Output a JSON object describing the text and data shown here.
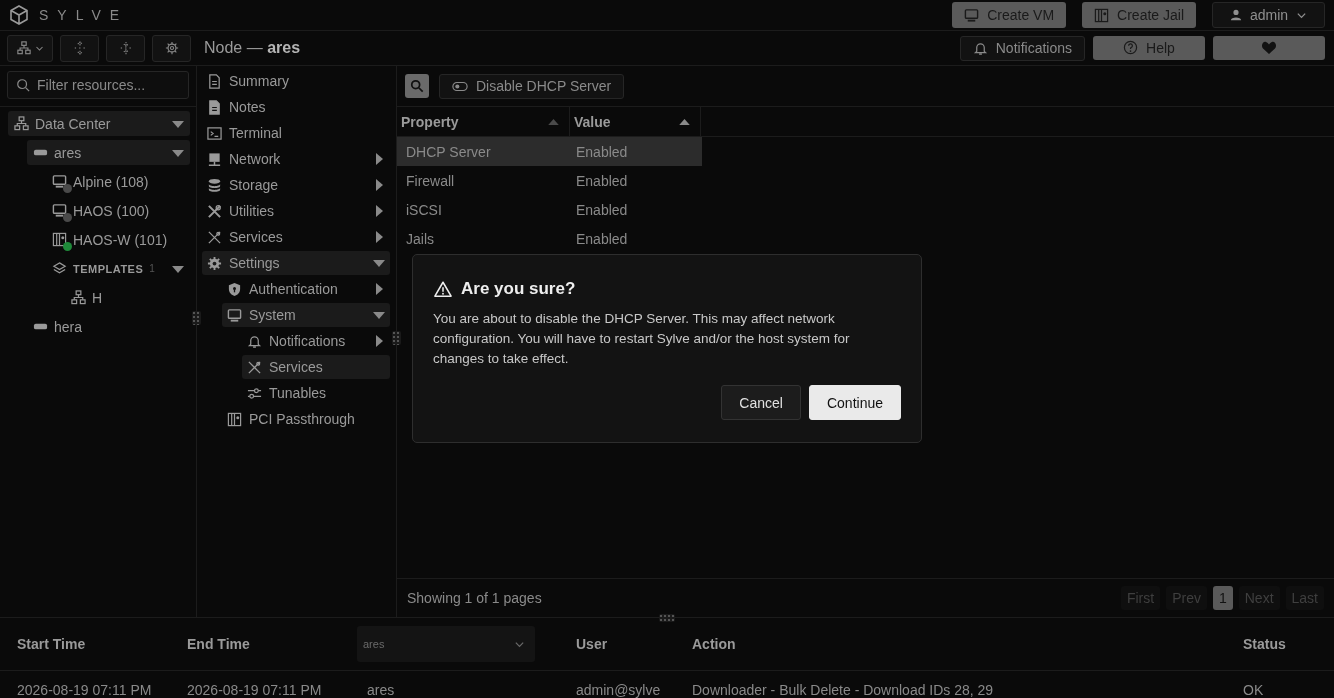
{
  "brand": "SYLVE",
  "header_buttons": [
    {
      "label": "Create VM",
      "kind": "vm"
    },
    {
      "label": "Create Jail",
      "kind": "jail"
    }
  ],
  "user_menu": {
    "label": "admin"
  },
  "page_title": {
    "prefix": "Node —",
    "name": "ares"
  },
  "top_actions": [
    {
      "label": "Notifications",
      "kind": "bell"
    },
    {
      "label": "Help",
      "kind": "help"
    }
  ],
  "filter": {
    "placeholder": "Filter resources..."
  },
  "tree": [
    {
      "label": "Data Center",
      "kind": "datacenter",
      "expanded": true,
      "selected": true,
      "children": [
        {
          "label": "ares",
          "kind": "node",
          "expanded": true,
          "selected": true,
          "children": [
            {
              "label": "Alpine (108)",
              "kind": "vm",
              "color": "#4a4a4a"
            },
            {
              "label": "HAOS (100)",
              "kind": "vm",
              "color": "#4a4a4a"
            },
            {
              "label": "HAOS-W (101)",
              "kind": "jail",
              "color": "#1f8a3a"
            },
            {
              "label": "TEMPLATES",
              "kind": "templates",
              "count": "1",
              "expanded": true,
              "children": [
                {
                  "label": "H",
                  "kind": "template"
                }
              ]
            }
          ]
        },
        {
          "label": "hera",
          "kind": "node",
          "expanded": false,
          "selected": false
        }
      ]
    }
  ],
  "menu": [
    {
      "label": "Summary",
      "kind": "summary"
    },
    {
      "label": "Notes",
      "kind": "notes"
    },
    {
      "label": "Terminal",
      "kind": "terminal"
    },
    {
      "label": "Network",
      "kind": "network",
      "expanded": false
    },
    {
      "label": "Storage",
      "kind": "storage",
      "expanded": false
    },
    {
      "label": "Utilities",
      "kind": "utilities",
      "expanded": false
    },
    {
      "label": "Services",
      "kind": "services",
      "expanded": false
    },
    {
      "label": "Settings",
      "kind": "settings",
      "expanded": true,
      "children": [
        {
          "label": "Authentication",
          "kind": "auth",
          "expanded": false
        },
        {
          "label": "System",
          "kind": "system",
          "expanded": true,
          "children": [
            {
              "label": "Notifications",
              "kind": "bell",
              "expanded": false
            },
            {
              "label": "Services",
              "kind": "services",
              "selected": true
            },
            {
              "label": "Tunables",
              "kind": "tunables",
              "selected": false
            }
          ]
        },
        {
          "label": "PCI Passthrough",
          "kind": "pci"
        }
      ]
    }
  ],
  "toolbar": {
    "action": "Disable DHCP Server"
  },
  "table": {
    "columns": [
      "Property",
      "Value"
    ],
    "rows": [
      {
        "property": "DHCP Server",
        "value": "Enabled",
        "selected": true
      },
      {
        "property": "Firewall",
        "value": "Enabled",
        "selected": false
      },
      {
        "property": "iSCSI",
        "value": "Enabled",
        "selected": false
      },
      {
        "property": "Jails",
        "value": "Enabled",
        "selected": false
      }
    ]
  },
  "pagination": {
    "summary": "Showing 1 of 1 pages",
    "buttons": [
      {
        "label": "First",
        "disabled": true
      },
      {
        "label": "Prev",
        "disabled": true
      },
      {
        "label": "1",
        "selected": true
      },
      {
        "label": "Next",
        "disabled": true
      },
      {
        "label": "Last",
        "disabled": true
      }
    ]
  },
  "log": {
    "columns": [
      {
        "label": "Start Time",
        "kind": "text"
      },
      {
        "label": "End Time",
        "kind": "text"
      },
      {
        "label": "ares",
        "kind": "select"
      },
      {
        "label": "User",
        "kind": "text"
      },
      {
        "label": "Action",
        "kind": "text"
      },
      {
        "label": "Status",
        "kind": "text"
      }
    ],
    "rows": [
      [
        "2026-08-19 07:11 PM",
        "2026-08-19 07:11 PM",
        "ares",
        "admin@sylve",
        "Downloader - Bulk Delete - Download IDs 28, 29",
        "OK"
      ]
    ]
  },
  "dialog": {
    "title": "Are you sure?",
    "message": "You are about to disable the DHCP Server. This may affect network configuration. You will have to restart Sylve and/or the host system for changes to take effect.",
    "buttons": [
      {
        "label": "Cancel",
        "kind": "secondary"
      },
      {
        "label": "Continue",
        "kind": "primary"
      }
    ]
  }
}
